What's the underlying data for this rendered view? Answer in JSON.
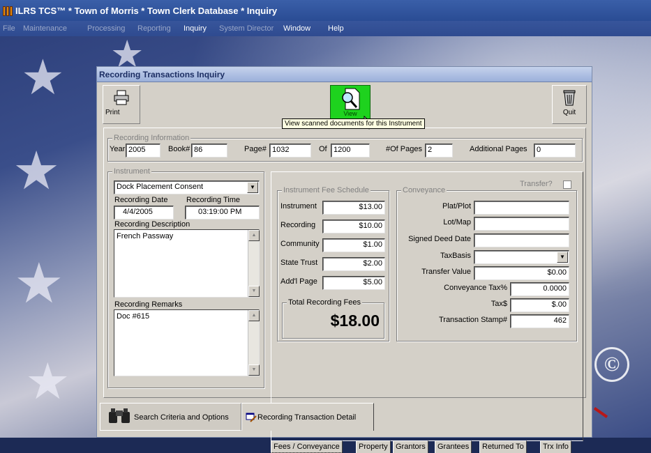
{
  "app": {
    "title": "ILRS TCS™ * Town of Morris * Town Clerk Database * Inquiry",
    "menu": [
      "File",
      "Maintenance",
      "Processing",
      "Reporting",
      "Inquiry",
      "System Director",
      "Window",
      "Help"
    ]
  },
  "window": {
    "title": "Recording Transactions Inquiry",
    "toolbar": {
      "print_label": "Print",
      "view_label": "View",
      "quit_label": "Quit"
    },
    "tooltip": "View scanned documents for this Instrument"
  },
  "recording_info": {
    "legend": "Recording Information",
    "year_label": "Year",
    "year": "2005",
    "book_label": "Book#",
    "book": "86",
    "page_label": "Page#",
    "page": "1032",
    "of_label": "Of",
    "of": "1200",
    "num_pages_label": "#Of Pages",
    "num_pages": "2",
    "additional_pages_label": "Additional Pages",
    "additional_pages": "0"
  },
  "instrument": {
    "legend": "Instrument",
    "type": "Dock Placement Consent",
    "recording_date_label": "Recording Date",
    "recording_date": "4/4/2005",
    "recording_time_label": "Recording Time",
    "recording_time": "03:19:00 PM",
    "description_label": "Recording Description",
    "description": "French Passway",
    "remarks_label": "Recording Remarks",
    "remarks": "Doc #615"
  },
  "transfer": {
    "label": "Transfer?"
  },
  "fee_schedule": {
    "legend": "Instrument Fee Schedule",
    "rows": [
      {
        "label": "Instrument",
        "value": "$13.00"
      },
      {
        "label": "Recording",
        "value": "$10.00"
      },
      {
        "label": "Community",
        "value": "$1.00"
      },
      {
        "label": "State Trust",
        "value": "$2.00"
      },
      {
        "label": "Add'l Page",
        "value": "$5.00"
      }
    ],
    "total_legend": "Total Recording Fees",
    "total": "$18.00"
  },
  "conveyance": {
    "legend": "Conveyance",
    "rows": [
      {
        "label": "Plat/Plot",
        "value": ""
      },
      {
        "label": "Lot/Map",
        "value": ""
      },
      {
        "label": "Signed Deed Date",
        "value": ""
      },
      {
        "label": "TaxBasis",
        "value": ""
      },
      {
        "label": "Transfer Value",
        "value": "$0.00"
      },
      {
        "label": "Conveyance Tax%",
        "value": "0.0000"
      },
      {
        "label": "Tax$",
        "value": "$.00"
      },
      {
        "label": "Transaction Stamp#",
        "value": "462"
      }
    ]
  },
  "tabs": [
    "Fees / Conveyance",
    "Property",
    "Grantors",
    "Grantees",
    "Returned To",
    "Trx Info"
  ],
  "bottom_tabs": [
    "Search Criteria and Options",
    "Recording Transaction Detail"
  ],
  "desktop": {
    "watermark": "©"
  },
  "colors": {
    "titlebar": "#2a4c94",
    "window_title": "#1c2e63",
    "view_button": "#1ed21e",
    "tooltip": "#ffffe1",
    "dialog_face": "#d4d0c8"
  }
}
